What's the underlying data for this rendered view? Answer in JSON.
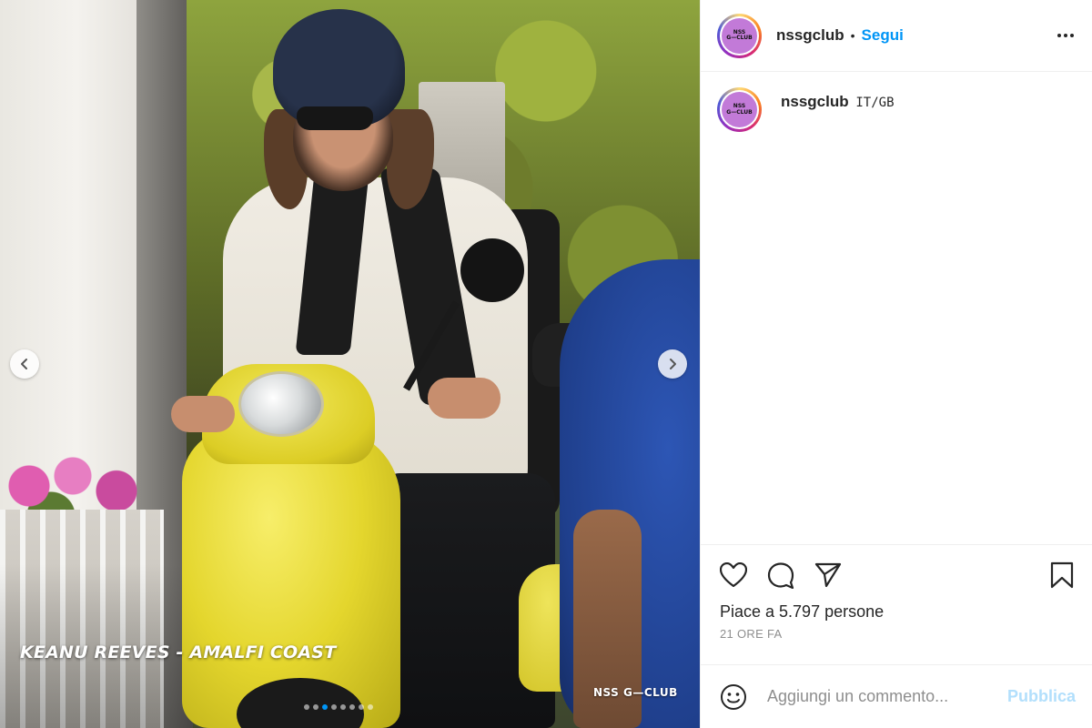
{
  "media": {
    "caption": "KEANU REEVES - AMALFI COAST",
    "watermark": "NSS G—CLUB",
    "carousel": {
      "total": 8,
      "active": 2
    }
  },
  "account": {
    "username": "nssgclub",
    "follow_label": "Segui",
    "separator": "•",
    "avatar_text_top": "NSS",
    "avatar_text_bottom": "G—CLUB"
  },
  "comments": [
    {
      "user": "nssgclub",
      "text": "IT/GB"
    }
  ],
  "engagement": {
    "likes_text": "Piace a 5.797 persone",
    "timestamp": "21 ORE FA"
  },
  "comment_box": {
    "placeholder": "Aggiungi un commento...",
    "publish_label": "Pubblica"
  },
  "colors": {
    "accent": "#0095f6",
    "publish_disabled": "#b2dffc",
    "muted": "#8e8e8e"
  }
}
